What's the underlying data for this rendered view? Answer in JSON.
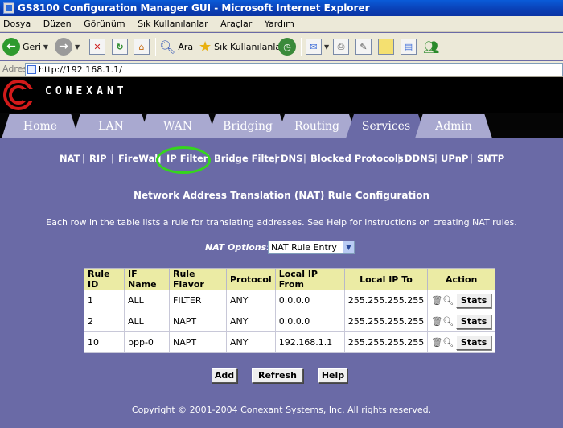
{
  "window": {
    "title": "GS8100 Configuration Manager GUI - Microsoft Internet Explorer"
  },
  "menubar": [
    "Dosya",
    "Düzen",
    "Görünüm",
    "Sık Kullanılanlar",
    "Araçlar",
    "Yardım"
  ],
  "toolbar": {
    "back": "Geri",
    "search": "Ara",
    "favorites": "Sık Kullanılanlar"
  },
  "address": {
    "label": "Adres",
    "url": "http://192.168.1.1/"
  },
  "brand": {
    "name": "CONEXANT"
  },
  "tabs": [
    {
      "label": "Home"
    },
    {
      "label": "LAN"
    },
    {
      "label": "WAN"
    },
    {
      "label": "Bridging"
    },
    {
      "label": "Routing"
    },
    {
      "label": "Services"
    },
    {
      "label": "Admin"
    }
  ],
  "active_tab": "Services",
  "subnav": [
    "NAT",
    "RIP",
    "FireWall",
    "IP Filter",
    "Bridge Filter",
    "DNS",
    "Blocked Protocols",
    "DDNS",
    "UPnP",
    "SNTP"
  ],
  "page": {
    "title": "Network Address Translation (NAT) Rule Configuration",
    "description": "Each row in the table lists a rule for translating addresses. See Help for instructions on creating NAT rules."
  },
  "nat_options": {
    "label": "NAT Options:",
    "selected": "NAT Rule Entry"
  },
  "table": {
    "headers": [
      "Rule ID",
      "IF Name",
      "Rule Flavor",
      "Protocol",
      "Local IP From",
      "Local IP To",
      "Action"
    ],
    "rows": [
      {
        "rule_id": "1",
        "if_name": "ALL",
        "flavor": "FILTER",
        "protocol": "ANY",
        "ip_from": "0.0.0.0",
        "ip_to": "255.255.255.255",
        "action": "Stats"
      },
      {
        "rule_id": "2",
        "if_name": "ALL",
        "flavor": "NAPT",
        "protocol": "ANY",
        "ip_from": "0.0.0.0",
        "ip_to": "255.255.255.255",
        "action": "Stats"
      },
      {
        "rule_id": "10",
        "if_name": "ppp-0",
        "flavor": "NAPT",
        "protocol": "ANY",
        "ip_from": "192.168.1.1",
        "ip_to": "255.255.255.255",
        "action": "Stats"
      }
    ]
  },
  "buttons": {
    "add": "Add",
    "refresh": "Refresh",
    "help": "Help"
  },
  "footer": "Copyright © 2001-2004 Conexant Systems, Inc. All rights reserved.",
  "colors": {
    "page_bg": "#6a6aa6",
    "tab_bg": "#a9a9d0",
    "table_header": "#ebeba4",
    "highlight_circle": "#35d61c"
  }
}
